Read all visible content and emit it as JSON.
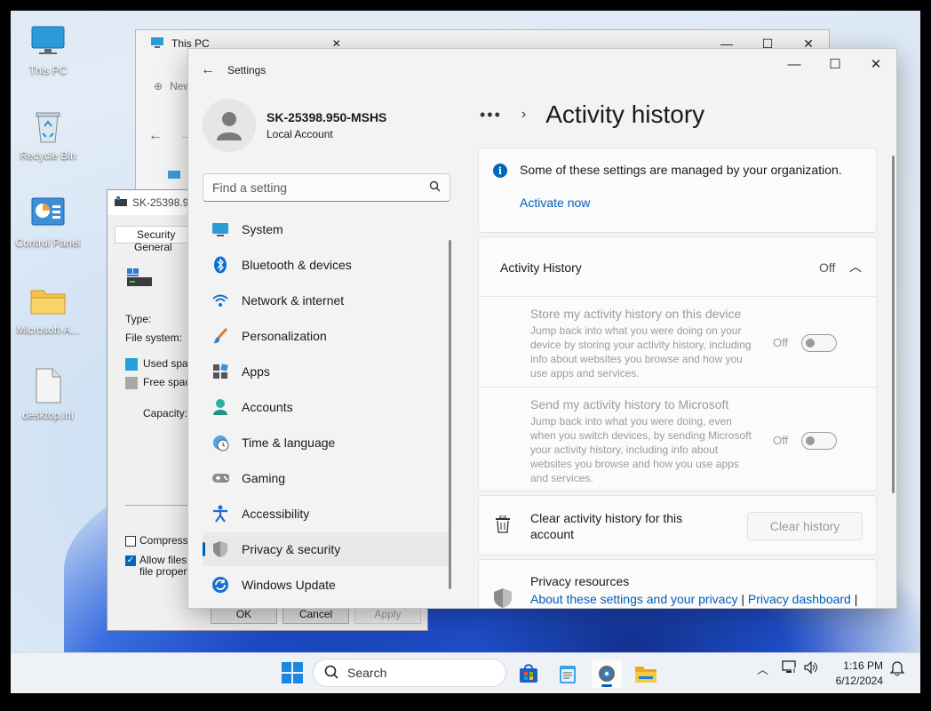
{
  "desktop": {
    "icons": [
      {
        "label": "This PC"
      },
      {
        "label": "Recycle Bin"
      },
      {
        "label": "Control Panel"
      },
      {
        "label": "Microsoft-A..."
      },
      {
        "label": "desktop.ini"
      }
    ]
  },
  "explorer": {
    "tab_title": "This PC",
    "new_label": "New"
  },
  "properties": {
    "title": "SK-25398.95...",
    "tabs": [
      "Security",
      "General"
    ],
    "type_label": "Type:",
    "fs_label": "File system:",
    "used_label": "Used space",
    "free_label": "Free space",
    "capacity_label": "Capacity:",
    "compress_label": "Compress th",
    "allow_label": "Allow files o",
    "allow_label2": "file properti",
    "ok": "OK",
    "cancel": "Cancel",
    "apply": "Apply",
    "colors": {
      "used": "#26a0da",
      "free": "#a8a8a8"
    }
  },
  "settings": {
    "app_title": "Settings",
    "profile": {
      "name": "SK-25398.950-MSHS",
      "account_type": "Local Account"
    },
    "search_placeholder": "Find a setting",
    "nav": [
      {
        "label": "System",
        "icon": "system-icon"
      },
      {
        "label": "Bluetooth & devices",
        "icon": "bluetooth-icon"
      },
      {
        "label": "Network & internet",
        "icon": "wifi-icon"
      },
      {
        "label": "Personalization",
        "icon": "brush-icon"
      },
      {
        "label": "Apps",
        "icon": "apps-icon"
      },
      {
        "label": "Accounts",
        "icon": "accounts-icon"
      },
      {
        "label": "Time & language",
        "icon": "time-icon"
      },
      {
        "label": "Gaming",
        "icon": "gamepad-icon"
      },
      {
        "label": "Accessibility",
        "icon": "accessibility-icon"
      },
      {
        "label": "Privacy & security",
        "icon": "shield-icon",
        "active": true
      },
      {
        "label": "Windows Update",
        "icon": "update-icon"
      }
    ],
    "page_title": "Activity history",
    "managed_notice": "Some of these settings are managed by your organization.",
    "activate_link": "Activate now",
    "section": {
      "title": "Activity History",
      "state": "Off"
    },
    "store": {
      "title": "Store my activity history on this device",
      "desc": "Jump back into what you were doing on your device by storing your activity history, including info about websites you browse and how you use apps and services.",
      "state": "Off"
    },
    "send": {
      "title": "Send my activity history to Microsoft",
      "desc": "Jump back into what you were doing, even when you switch devices, by sending Microsoft your activity history, including info about websites you browse and how you use apps and services.",
      "state": "Off"
    },
    "clear": {
      "title": "Clear activity history for this account",
      "button": "Clear history"
    },
    "resources": {
      "title": "Privacy resources",
      "link1": "About these settings and your privacy",
      "link2": "Privacy dashboard",
      "sep": "|"
    },
    "accent": "#005fb8"
  },
  "taskbar": {
    "search_label": "Search",
    "time": "1:16 PM",
    "date": "6/12/2024"
  }
}
